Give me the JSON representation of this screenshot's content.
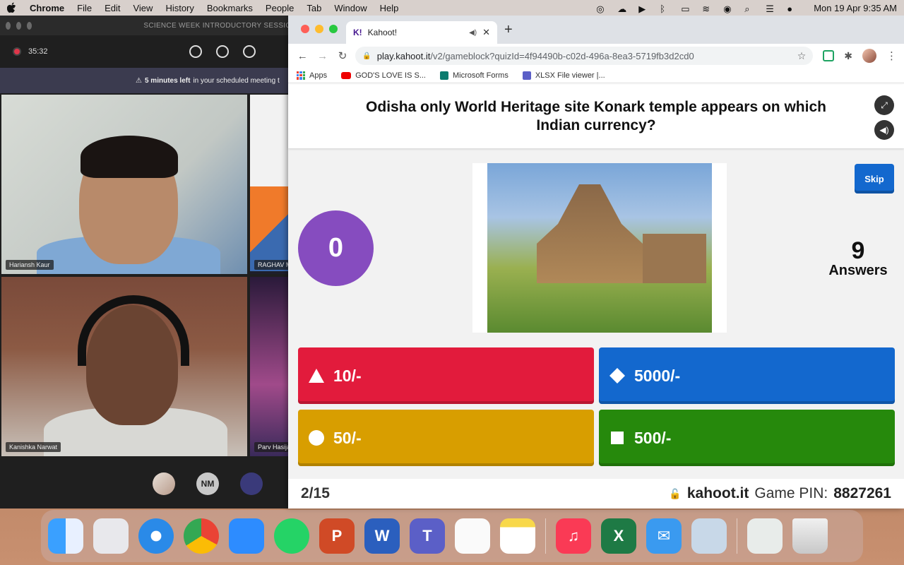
{
  "menubar": {
    "app_name": "Chrome",
    "items": [
      "File",
      "Edit",
      "View",
      "History",
      "Bookmarks",
      "People",
      "Tab",
      "Window",
      "Help"
    ],
    "clock": "Mon 19 Apr  9:35 AM"
  },
  "teams": {
    "window_title": "SCIENCE WEEK INTRODUCTORY SESSION",
    "timer": "35:32",
    "banner_bold": "5 minutes left",
    "banner_rest": "in your scheduled meeting t",
    "participants": [
      "Hariansh Kaur",
      "RAGHAV M",
      "Kanishka Narwat",
      "Parv Hasija"
    ],
    "bottom_avatar_initials": "NM"
  },
  "browser": {
    "tab_title": "Kahoot!",
    "tab_favicon": "K!",
    "url_host": "play.kahoot.it",
    "url_path": "/v2/gameblock?quizId=4f94490b-c02d-496a-8ea3-5719fb3d2cd0",
    "bookmarks": [
      "Apps",
      "GOD'S LOVE IS S...",
      "Microsoft Forms",
      "XLSX File viewer |..."
    ]
  },
  "kahoot": {
    "question": "Odisha only World Heritage site Konark temple appears on which Indian currency?",
    "timer_value": "0",
    "skip_label": "Skip",
    "answers_count": "9",
    "answers_label": "Answers",
    "answers": [
      {
        "label": "10/-",
        "shape": "triangle-icon",
        "color": "#e21b3c"
      },
      {
        "label": "5000/-",
        "shape": "diamond-icon",
        "color": "#1368ce"
      },
      {
        "label": "50/-",
        "shape": "circle-icon",
        "color": "#d89e00"
      },
      {
        "label": "500/-",
        "shape": "square-icon",
        "color": "#26890c"
      }
    ],
    "progress": "2/15",
    "site": "kahoot.it",
    "pin_label": "Game PIN:",
    "pin": "8827261"
  },
  "dock": {
    "apps": [
      "finder-icon",
      "launchpad-icon",
      "safari-icon",
      "chrome-icon",
      "zoom-icon",
      "whatsapp-icon",
      "powerpoint-icon",
      "word-icon",
      "teams-icon",
      "reminders-icon",
      "notes-icon",
      "music-icon",
      "excel-icon",
      "mail-icon",
      "preview-icon",
      "screenshot-icon",
      "trash-icon"
    ],
    "letters": {
      "powerpoint": "P",
      "word": "W",
      "teams": "T",
      "excel": "X"
    }
  }
}
